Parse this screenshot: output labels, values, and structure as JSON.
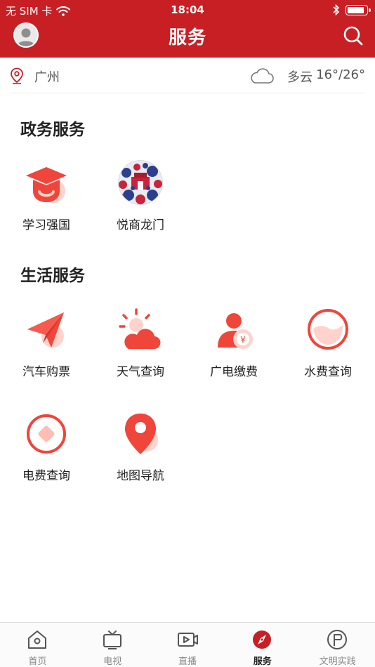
{
  "status_bar": {
    "carrier": "无 SIM 卡",
    "time": "18:04",
    "battery_level": 0.9
  },
  "header": {
    "title": "服务"
  },
  "info_bar": {
    "city": "广州",
    "weather": "多云",
    "temperature": "16°/26°"
  },
  "sections": {
    "government": {
      "title": "政务服务",
      "items": [
        {
          "label": "学习强国",
          "icon": "graduation-cap-icon"
        },
        {
          "label": "悦商龙门",
          "icon": "yueshang-longmen-logo"
        }
      ]
    },
    "life": {
      "title": "生活服务",
      "items": [
        {
          "label": "汽车购票",
          "icon": "paper-plane-icon"
        },
        {
          "label": "天气查询",
          "icon": "sun-cloud-icon"
        },
        {
          "label": "广电缴费",
          "icon": "user-yen-icon"
        },
        {
          "label": "水费查询",
          "icon": "water-drop-icon"
        },
        {
          "label": "电费查询",
          "icon": "diamond-circle-icon"
        },
        {
          "label": "地图导航",
          "icon": "map-pin-icon"
        }
      ]
    }
  },
  "tabbar": {
    "active": "服务",
    "items": [
      {
        "label": "首页",
        "icon": "home-icon"
      },
      {
        "label": "电视",
        "icon": "tv-icon"
      },
      {
        "label": "直播",
        "icon": "live-play-icon"
      },
      {
        "label": "服务",
        "icon": "compass-icon"
      },
      {
        "label": "文明实践",
        "icon": "flag-circle-icon"
      }
    ]
  },
  "colors": {
    "brand_red": "#c81f24",
    "icon_red": "#f0453a",
    "icon_light": "#ffd3cc"
  }
}
